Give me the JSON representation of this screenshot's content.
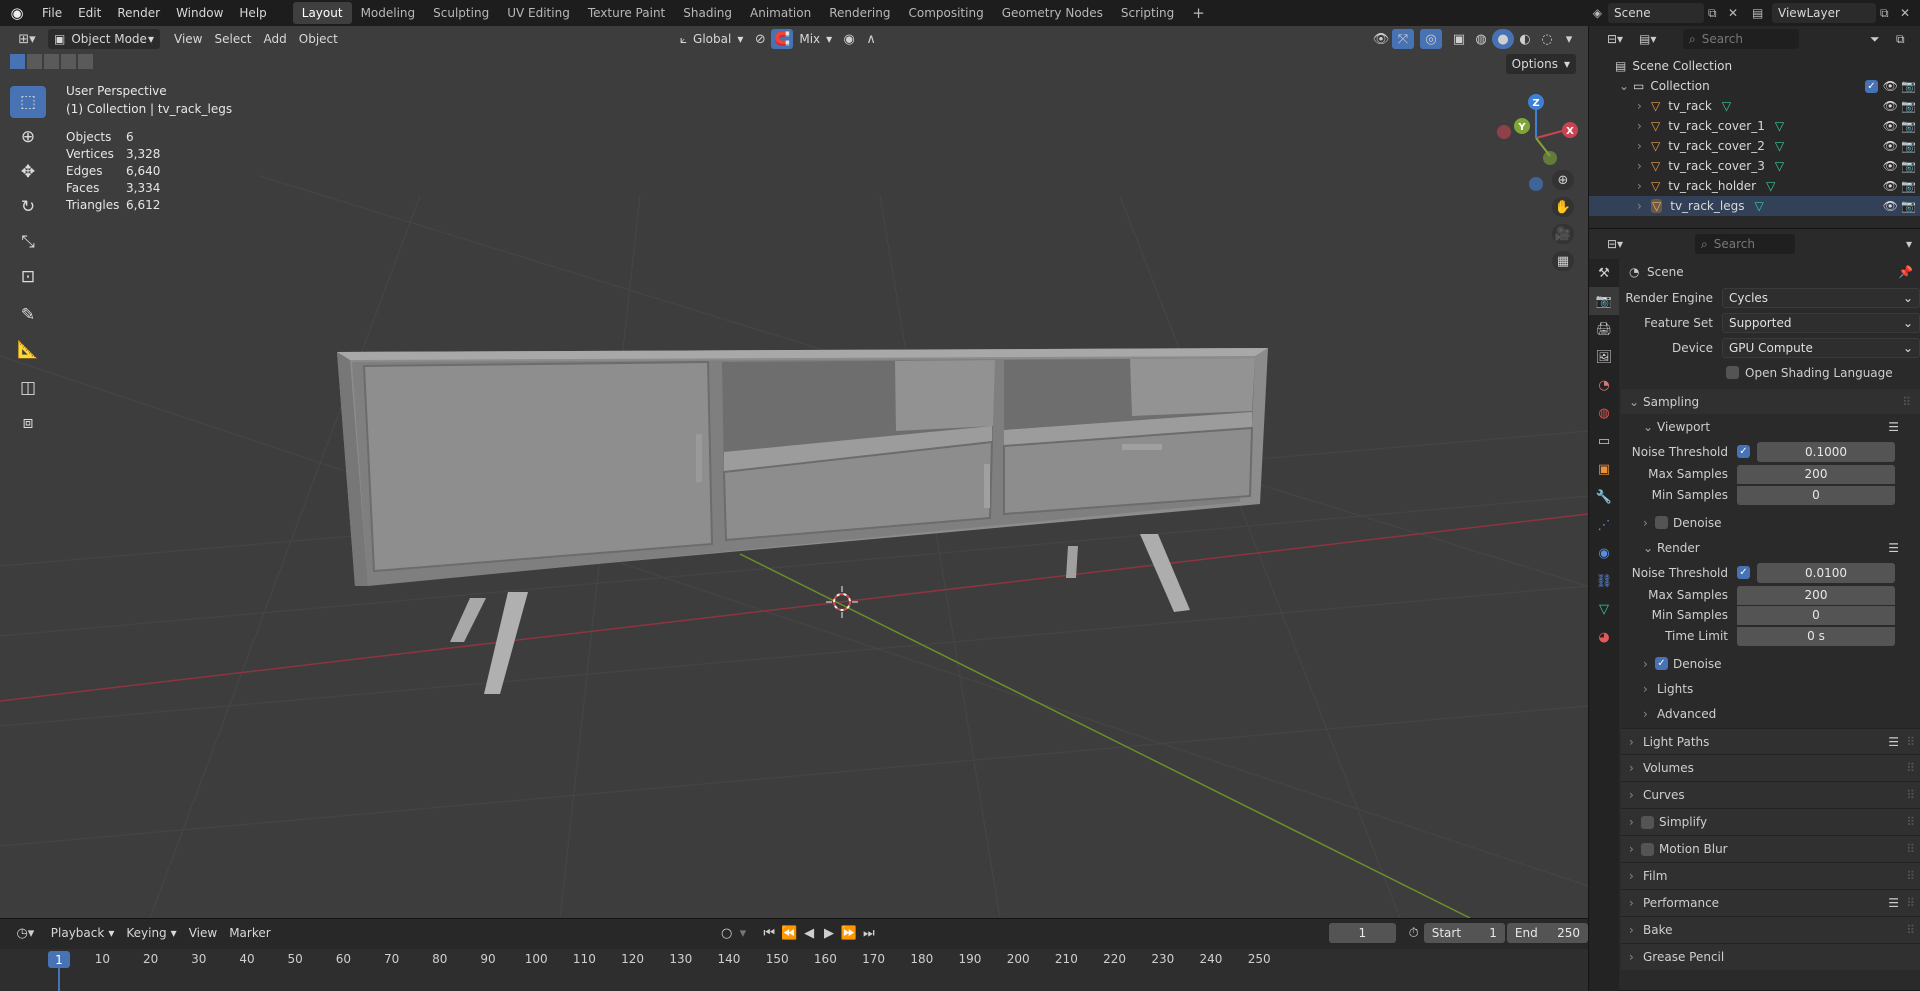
{
  "topbar": {
    "menus": [
      "File",
      "Edit",
      "Render",
      "Window",
      "Help"
    ],
    "workspaces": [
      "Layout",
      "Modeling",
      "Sculpting",
      "UV Editing",
      "Texture Paint",
      "Shading",
      "Animation",
      "Rendering",
      "Compositing",
      "Geometry Nodes",
      "Scripting"
    ],
    "active_workspace": "Layout",
    "scene": "Scene",
    "view_layer": "ViewLayer"
  },
  "viewport_header": {
    "mode": "Object Mode",
    "menus": [
      "View",
      "Select",
      "Add",
      "Object"
    ],
    "orientation": "Global",
    "snap_mode": "Mix",
    "options_label": "Options"
  },
  "overlay": {
    "perspective": "User Perspective",
    "collection_line": "(1) Collection | tv_rack_legs",
    "stats": [
      {
        "k": "Objects",
        "v": "6"
      },
      {
        "k": "Vertices",
        "v": "3,328"
      },
      {
        "k": "Edges",
        "v": "6,640"
      },
      {
        "k": "Faces",
        "v": "3,334"
      },
      {
        "k": "Triangles",
        "v": "6,612"
      }
    ]
  },
  "gizmo": {
    "x": "X",
    "y": "Y",
    "z": "Z"
  },
  "outliner": {
    "search_placeholder": "Search",
    "scene_collection": "Scene Collection",
    "collection": "Collection",
    "objects": [
      "tv_rack",
      "tv_rack_cover_1",
      "tv_rack_cover_2",
      "tv_rack_cover_3",
      "tv_rack_holder",
      "tv_rack_legs"
    ],
    "active_object": "tv_rack_legs"
  },
  "properties": {
    "search_placeholder": "Search",
    "context": "Scene",
    "render_engine_label": "Render Engine",
    "render_engine": "Cycles",
    "feature_set_label": "Feature Set",
    "feature_set": "Supported",
    "device_label": "Device",
    "device": "GPU Compute",
    "osl_label": "Open Shading Language",
    "sampling": "Sampling",
    "viewport": "Viewport",
    "noise_threshold_label": "Noise Threshold",
    "viewport_noise": "0.1000",
    "max_samples_label": "Max Samples",
    "viewport_max": "200",
    "min_samples_label": "Min Samples",
    "viewport_min": "0",
    "denoise": "Denoise",
    "render": "Render",
    "render_noise": "0.0100",
    "render_max": "200",
    "render_min": "0",
    "time_limit_label": "Time Limit",
    "time_limit": "0 s",
    "lights": "Lights",
    "advanced": "Advanced",
    "panels": [
      "Light Paths",
      "Volumes",
      "Curves",
      "Simplify",
      "Motion Blur",
      "Film",
      "Performance",
      "Bake",
      "Grease Pencil"
    ]
  },
  "timeline": {
    "menus": [
      "Playback",
      "Keying",
      "View",
      "Marker"
    ],
    "current_frame": "1",
    "start_label": "Start",
    "start": "1",
    "end_label": "End",
    "end": "250",
    "ruler": [
      "1",
      "10",
      "20",
      "30",
      "40",
      "50",
      "60",
      "70",
      "80",
      "90",
      "100",
      "110",
      "120",
      "130",
      "140",
      "150",
      "160",
      "170",
      "180",
      "190",
      "200",
      "210",
      "220",
      "230",
      "240",
      "250"
    ]
  },
  "colors": {
    "accent": "#4772b3",
    "x_axis": "#c74553",
    "y_axis": "#7fa53a",
    "z_axis": "#3f7fd6"
  }
}
